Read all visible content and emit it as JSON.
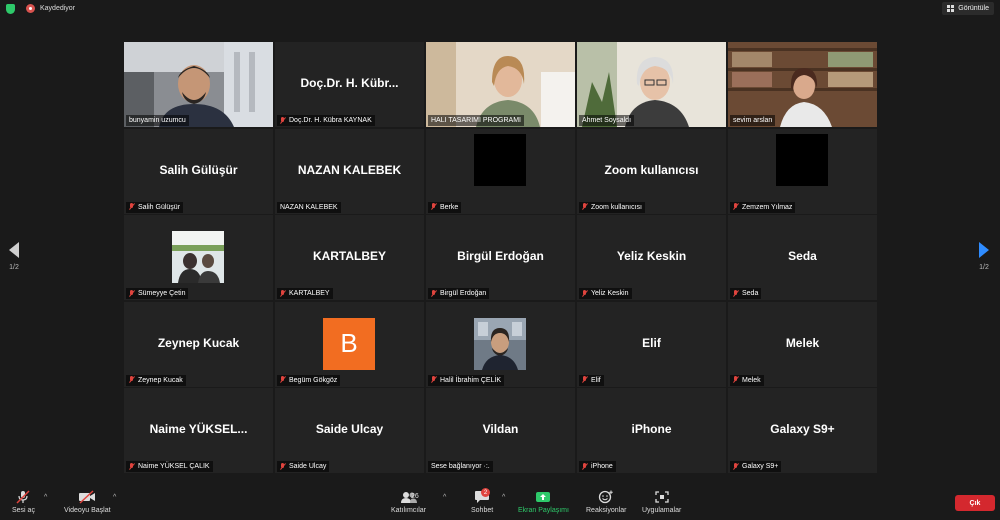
{
  "topbar": {
    "recording_label": "Kaydediyor",
    "view_label": "Görüntüle"
  },
  "pager": {
    "left": "1/2",
    "right": "1/2"
  },
  "tiles": [
    {
      "display": "",
      "label": "bunyamin uzumcu",
      "muted": false
    },
    {
      "display": "Doç.Dr. H. Kübr...",
      "label": "Doç.Dr. H. Kübra KAYNAK",
      "muted": true
    },
    {
      "display": "",
      "label": "HALI TASARIMI PROGRAMI",
      "muted": false
    },
    {
      "display": "",
      "label": "Ahmet Soysaldı",
      "muted": false
    },
    {
      "display": "",
      "label": "sevim arslan",
      "muted": false
    },
    {
      "display": "Salih Gülüşür",
      "label": "Salih Gülüşür",
      "muted": true
    },
    {
      "display": "NAZAN KALEBEK",
      "label": "NAZAN KALEBEK",
      "muted": false
    },
    {
      "display": "",
      "label": "Berke",
      "muted": true
    },
    {
      "display": "Zoom kullanıcısı",
      "label": "Zoom kullanıcısı",
      "muted": true
    },
    {
      "display": "",
      "label": "Zemzem Yılmaz",
      "muted": true
    },
    {
      "display": "",
      "label": "Sümeyye Çetin",
      "muted": true
    },
    {
      "display": "KARTALBEY",
      "label": "KARTALBEY",
      "muted": true
    },
    {
      "display": "Birgül Erdoğan",
      "label": "Birgül Erdoğan",
      "muted": true
    },
    {
      "display": "Yeliz Keskin",
      "label": "Yeliz Keskin",
      "muted": true
    },
    {
      "display": "Seda",
      "label": "Seda",
      "muted": true
    },
    {
      "display": "Zeynep Kucak",
      "label": "Zeynep Kucak",
      "muted": true
    },
    {
      "display": "B",
      "label": "Begüm Gökgöz",
      "muted": true
    },
    {
      "display": "",
      "label": "Halil İbrahim ÇELİK",
      "muted": true
    },
    {
      "display": "Elif",
      "label": "Elif",
      "muted": true
    },
    {
      "display": "Melek",
      "label": "Melek",
      "muted": true
    },
    {
      "display": "Naime  YÜKSEL...",
      "label": "Naime YÜKSEL ÇALIK",
      "muted": true
    },
    {
      "display": "Saide Ulcay",
      "label": "Saide Ulcay",
      "muted": true
    },
    {
      "display": "Vildan",
      "label": "Sese bağlanıyor ·:.",
      "muted": false
    },
    {
      "display": "iPhone",
      "label": "iPhone",
      "muted": true
    },
    {
      "display": "Galaxy S9+",
      "label": "Galaxy S9+",
      "muted": true
    }
  ],
  "toolbar": {
    "audio_label": "Sesi aç",
    "video_label": "Videoyu Başlat",
    "participants_label": "Katılımcılar",
    "participants_count": "26",
    "chat_label": "Sohbet",
    "chat_badge": "2",
    "share_label": "Ekran Paylaşımı",
    "reactions_label": "Reaksiyonlar",
    "apps_label": "Uygulamalar",
    "leave_label": "Çık"
  },
  "colors": {
    "active_speaker": "#c9df3c",
    "mute_icon": "#e0443e",
    "share_green": "#2ec96a",
    "leave_red": "#d4282e",
    "avatar_orange": "#f26d21"
  }
}
